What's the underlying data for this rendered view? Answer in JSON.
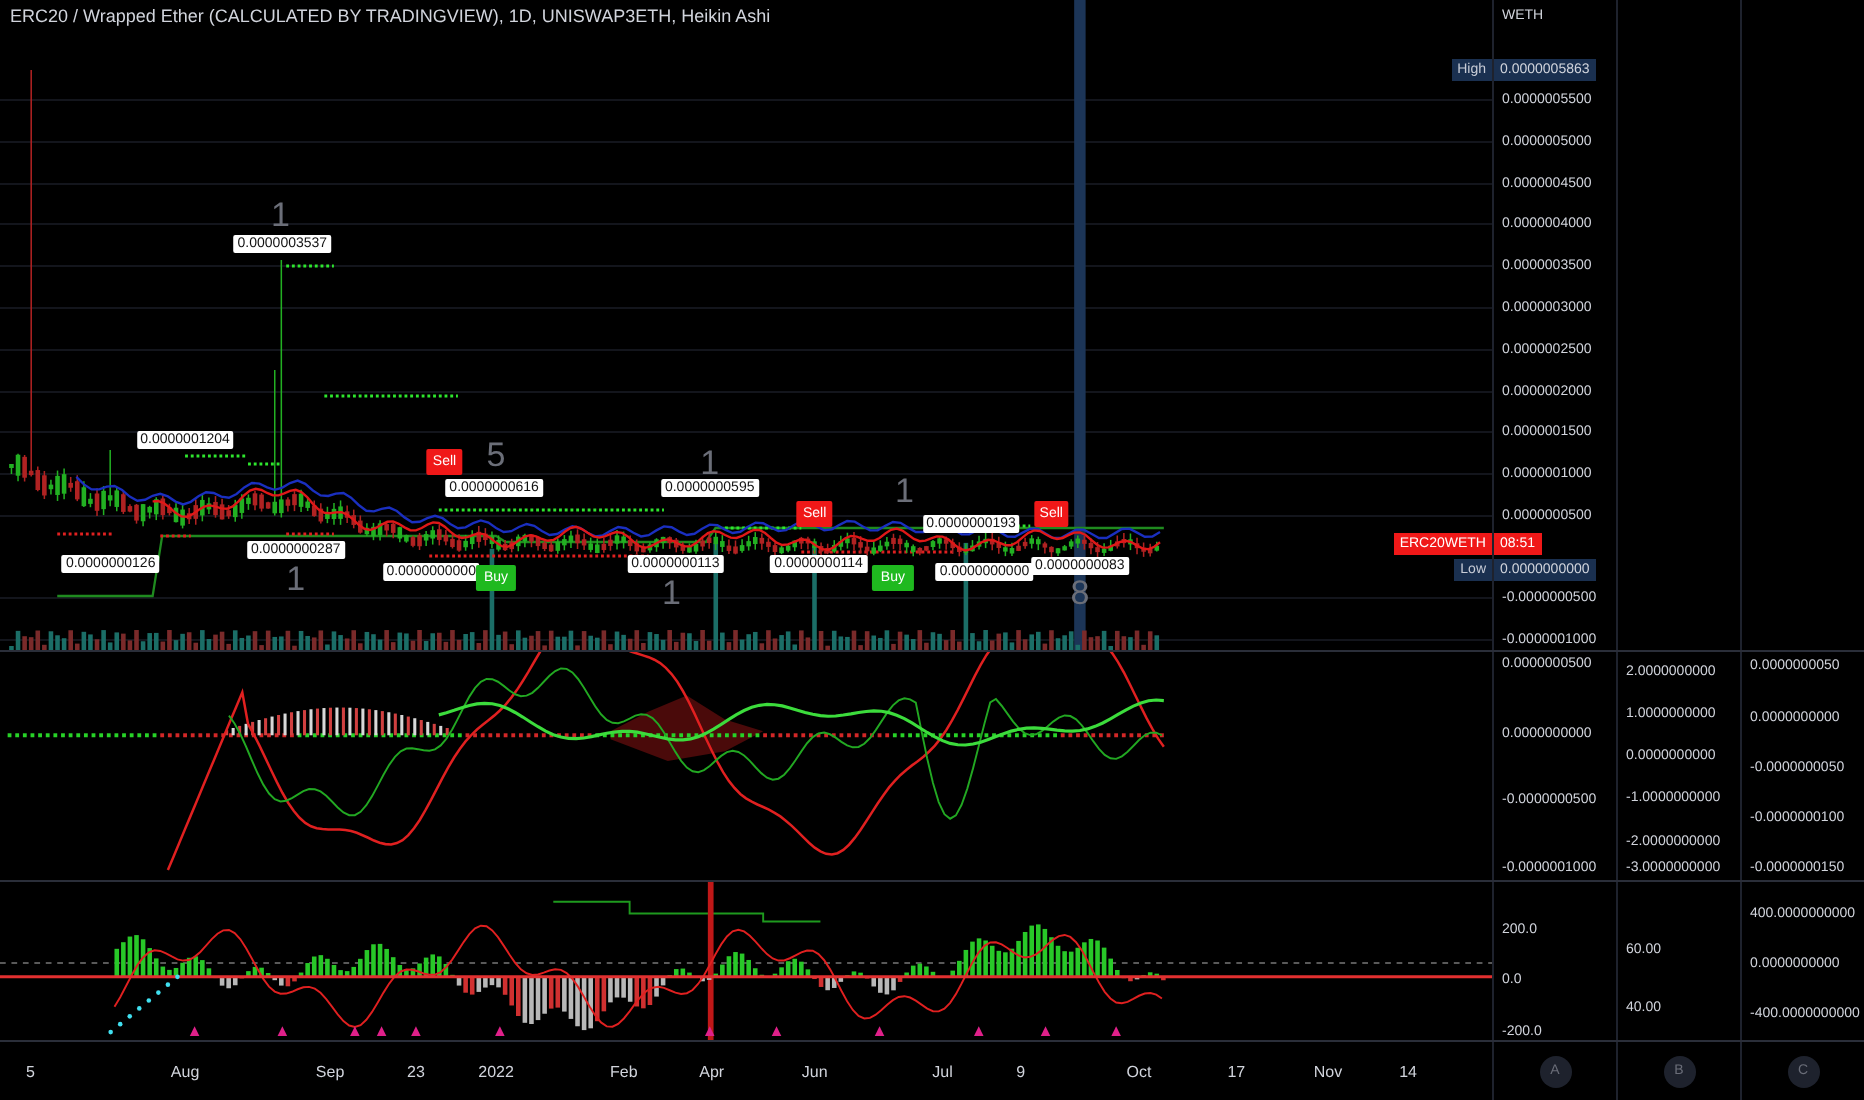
{
  "header": {
    "title": "ERC20 / Wrapped Ether (CALCULATED BY TRADINGVIEW), 1D, UNISWAP3ETH, Heikin Ashi"
  },
  "price_axis": {
    "currency": "WETH",
    "ticks": [
      "0.0000005500",
      "0.0000005000",
      "0.0000004500",
      "0.0000004000",
      "0.0000003500",
      "0.0000003000",
      "0.0000002500",
      "0.0000002000",
      "0.0000001500",
      "0.0000001000",
      "0.0000000500",
      "-0.0000000500",
      "-0.0000001000"
    ],
    "high": {
      "label": "High",
      "value": "0.0000005863"
    },
    "low": {
      "label": "Low",
      "value": "0.0000000000"
    },
    "last": {
      "symbol": "ERC20WETH",
      "countdown": "08:51"
    }
  },
  "chart_labels": [
    {
      "kind": "peak",
      "text": "0.0000003537"
    },
    {
      "kind": "peak",
      "text": "0.0000001204"
    },
    {
      "kind": "trough",
      "text": "0.0000000126"
    },
    {
      "kind": "trough",
      "text": "0.0000000287"
    },
    {
      "kind": "trough",
      "text": "0.0000000000"
    },
    {
      "kind": "peak",
      "text": "0.0000000616"
    },
    {
      "kind": "peak",
      "text": "0.0000000595"
    },
    {
      "kind": "trough",
      "text": "0.0000000113"
    },
    {
      "kind": "trough",
      "text": "0.0000000114"
    },
    {
      "kind": "peak",
      "text": "0.0000000193"
    },
    {
      "kind": "trough",
      "text": "0.0000000000"
    },
    {
      "kind": "trough",
      "text": "0.0000000083"
    },
    {
      "kind": "sell",
      "text": "Sell"
    },
    {
      "kind": "buy",
      "text": "Buy"
    },
    {
      "kind": "sell",
      "text": "Sell"
    },
    {
      "kind": "buy",
      "text": "Buy"
    },
    {
      "kind": "sell",
      "text": "Sell"
    }
  ],
  "wave_counts": [
    "1",
    "5",
    "1",
    "1",
    "1",
    "1",
    "8"
  ],
  "oscillator_axes": [
    [
      "0.0000000500",
      "0.0000000000",
      "-0.0000000500",
      "-0.0000001000"
    ],
    [
      "2.0000000000",
      "1.0000000000",
      "0.0000000000",
      "-1.0000000000",
      "-2.0000000000",
      "-3.0000000000"
    ],
    [
      "0.0000000050",
      "0.0000000000",
      "-0.0000000050",
      "-0.0000000100",
      "-0.0000000150"
    ]
  ],
  "indicator_axes": [
    [
      "200.0",
      "0.0",
      "-200.0"
    ],
    [
      "60.00",
      "40.00"
    ],
    [
      "400.0000000000",
      "0.0000000000",
      "-400.0000000000"
    ]
  ],
  "time_axis": {
    "labels": [
      "5",
      "Aug",
      "Sep",
      "23",
      "2022",
      "Feb",
      "Apr",
      "Jun",
      "Jul",
      "9",
      "Oct",
      "17",
      "Nov",
      "14"
    ],
    "scale_buttons": [
      "A",
      "B",
      "C"
    ]
  }
}
